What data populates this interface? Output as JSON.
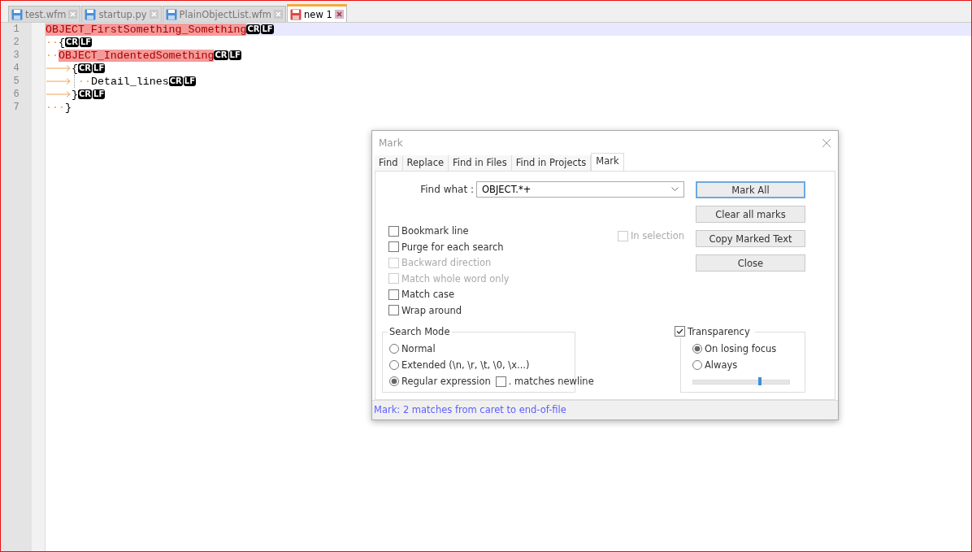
{
  "tabs": [
    {
      "label": "test.wfm",
      "selected": false,
      "modified": false
    },
    {
      "label": "startup.py",
      "selected": false,
      "modified": false
    },
    {
      "label": "PlainObjectList.wfm",
      "selected": false,
      "modified": false
    },
    {
      "label": "new 1",
      "selected": true,
      "modified": true
    }
  ],
  "editor": {
    "lines": [
      {
        "number": "1",
        "current": true,
        "segments": [
          {
            "kind": "marked",
            "text": "OBJECT_FirstSomething_Something"
          },
          {
            "kind": "eol",
            "text": "CR"
          },
          {
            "kind": "eol",
            "text": "LF"
          }
        ]
      },
      {
        "number": "2",
        "current": false,
        "segments": [
          {
            "kind": "space",
            "text": "··"
          },
          {
            "kind": "text",
            "text": "{"
          },
          {
            "kind": "eol",
            "text": "CR"
          },
          {
            "kind": "eol",
            "text": "LF"
          }
        ]
      },
      {
        "number": "3",
        "current": false,
        "segments": [
          {
            "kind": "space",
            "text": "··"
          },
          {
            "kind": "marked",
            "text": "OBJECT_IndentedSomething"
          },
          {
            "kind": "eol",
            "text": "CR"
          },
          {
            "kind": "eol",
            "text": "LF"
          }
        ]
      },
      {
        "number": "4",
        "current": false,
        "segments": [
          {
            "kind": "tab"
          },
          {
            "kind": "text",
            "text": "{"
          },
          {
            "kind": "eol",
            "text": "CR"
          },
          {
            "kind": "eol",
            "text": "LF"
          }
        ]
      },
      {
        "number": "5",
        "current": false,
        "segments": [
          {
            "kind": "tab"
          },
          {
            "kind": "guide"
          },
          {
            "kind": "space",
            "text": "··"
          },
          {
            "kind": "text",
            "text": "Detail_lines"
          },
          {
            "kind": "eol",
            "text": "CR"
          },
          {
            "kind": "eol",
            "text": "LF"
          }
        ]
      },
      {
        "number": "6",
        "current": false,
        "segments": [
          {
            "kind": "tab"
          },
          {
            "kind": "text",
            "text": "}"
          },
          {
            "kind": "eol",
            "text": "CR"
          },
          {
            "kind": "eol",
            "text": "LF"
          }
        ]
      },
      {
        "number": "7",
        "current": false,
        "segments": [
          {
            "kind": "space",
            "text": "···"
          },
          {
            "kind": "text",
            "text": "}"
          }
        ]
      }
    ]
  },
  "dialog": {
    "title": "Mark",
    "tabs": [
      {
        "label": "Find",
        "selected": false
      },
      {
        "label": "Replace",
        "selected": false
      },
      {
        "label": "Find in Files",
        "selected": false
      },
      {
        "label": "Find in Projects",
        "selected": false
      },
      {
        "label": "Mark",
        "selected": true
      }
    ],
    "find_what": {
      "label": "Find what :",
      "value": "OBJECT.*+"
    },
    "options": [
      {
        "label": "Bookmark line",
        "checked": false,
        "disabled": false
      },
      {
        "label": "Purge for each search",
        "checked": false,
        "disabled": false
      },
      {
        "label": "Backward direction",
        "checked": false,
        "disabled": true
      },
      {
        "label": "Match whole word only",
        "checked": false,
        "disabled": true
      },
      {
        "label": "Match case",
        "checked": false,
        "disabled": false
      },
      {
        "label": "Wrap around",
        "checked": false,
        "disabled": false
      }
    ],
    "in_selection": {
      "label": "In selection",
      "checked": false,
      "disabled": true
    },
    "buttons": [
      {
        "label": "Mark All",
        "focused": true
      },
      {
        "label": "Clear all marks",
        "focused": false
      },
      {
        "label": "Copy Marked Text",
        "focused": false
      },
      {
        "label": "Close",
        "focused": false
      }
    ],
    "search_mode": {
      "title": "Search Mode",
      "modes": [
        {
          "label": "Normal",
          "selected": false
        },
        {
          "label": "Extended (\\n, \\r, \\t, \\0, \\x...)",
          "selected": false
        },
        {
          "label": "Regular expression",
          "selected": true
        }
      ],
      "matches_newline": {
        "label": ". matches newline",
        "checked": false
      }
    },
    "transparency": {
      "label": "Transparency",
      "checked": true,
      "modes": [
        {
          "label": "On losing focus",
          "selected": true
        },
        {
          "label": "Always",
          "selected": false
        }
      ],
      "level": 0.7
    },
    "status": "Mark: 2 matches from caret to end-of-file"
  }
}
